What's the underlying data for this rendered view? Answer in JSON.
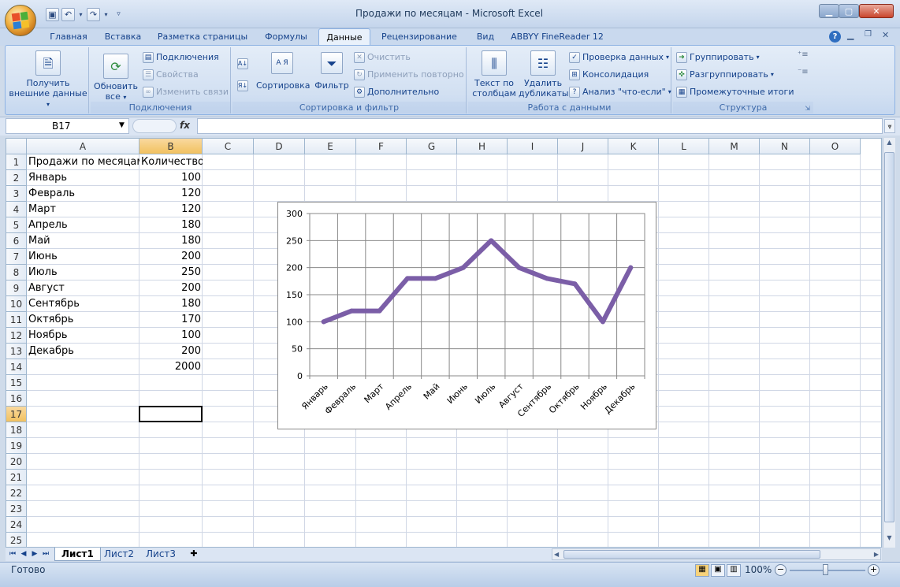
{
  "window": {
    "title": "Продажи по месяцам - Microsoft Excel",
    "controls": [
      "minimize-icon",
      "maximize-icon",
      "close-icon"
    ]
  },
  "quick_access": [
    "save-icon",
    "undo-icon",
    "redo-icon",
    "customize-icon"
  ],
  "ribbon_tabs": [
    {
      "label": "Главная"
    },
    {
      "label": "Вставка"
    },
    {
      "label": "Разметка страницы"
    },
    {
      "label": "Формулы"
    },
    {
      "label": "Данные",
      "active": true
    },
    {
      "label": "Рецензирование"
    },
    {
      "label": "Вид"
    },
    {
      "label": "ABBYY FineReader 12"
    }
  ],
  "ribbon": {
    "get_external": {
      "line1": "Получить",
      "line2": "внешние данные"
    },
    "connections": {
      "label": "Подключения",
      "refresh_line1": "Обновить",
      "refresh_line2": "все",
      "connections_btn": "Подключения",
      "properties_btn": "Свойства",
      "edit_links_btn": "Изменить связи"
    },
    "sort_filter": {
      "label": "Сортировка и фильтр",
      "sort_asc": "А Я",
      "sort_btn": "Сортировка",
      "filter_btn": "Фильтр",
      "clear_btn": "Очистить",
      "reapply_btn": "Применить повторно",
      "advanced_btn": "Дополнительно"
    },
    "data_tools": {
      "label": "Работа с данными",
      "text_to_cols_line1": "Текст по",
      "text_to_cols_line2": "столбцам",
      "remove_dup_line1": "Удалить",
      "remove_dup_line2": "дубликаты",
      "validation_btn": "Проверка данных",
      "consolidate_btn": "Консолидация",
      "whatif_btn": "Анализ \"что-если\""
    },
    "outline": {
      "label": "Структура",
      "group_btn": "Группировать",
      "ungroup_btn": "Разгруппировать",
      "subtotal_btn": "Промежуточные итоги"
    }
  },
  "formula_bar": {
    "name_box": "B17",
    "fx": "fx",
    "formula": ""
  },
  "columns": [
    "A",
    "B",
    "C",
    "D",
    "E",
    "F",
    "G",
    "H",
    "I",
    "J",
    "K",
    "L",
    "M",
    "N",
    "O"
  ],
  "rows": [
    "1",
    "2",
    "3",
    "4",
    "5",
    "6",
    "7",
    "8",
    "9",
    "10",
    "11",
    "12",
    "13",
    "14",
    "15",
    "16",
    "17",
    "18",
    "19",
    "20",
    "21",
    "22",
    "23",
    "24",
    "25"
  ],
  "selected_cell": {
    "column": "B",
    "row": "17"
  },
  "table": {
    "header_a": "Продажи по месяцам",
    "header_b": "Количество",
    "data": [
      {
        "month": "Январь",
        "qty": "100"
      },
      {
        "month": "Февраль",
        "qty": "120"
      },
      {
        "month": "Март",
        "qty": "120"
      },
      {
        "month": "Апрель",
        "qty": "180"
      },
      {
        "month": "Май",
        "qty": "180"
      },
      {
        "month": "Июнь",
        "qty": "200"
      },
      {
        "month": "Июль",
        "qty": "250"
      },
      {
        "month": "Август",
        "qty": "200"
      },
      {
        "month": "Сентябрь",
        "qty": "180"
      },
      {
        "month": "Октябрь",
        "qty": "170"
      },
      {
        "month": "Ноябрь",
        "qty": "100"
      },
      {
        "month": "Декабрь",
        "qty": "200"
      }
    ],
    "total": "2000"
  },
  "chart_data": {
    "type": "line",
    "categories": [
      "Январь",
      "Февраль",
      "Март",
      "Апрель",
      "Май",
      "Июнь",
      "Июль",
      "Август",
      "Сентябрь",
      "Октябрь",
      "Ноябрь",
      "Декабрь"
    ],
    "series": [
      {
        "values": [
          100,
          120,
          120,
          180,
          180,
          200,
          250,
          200,
          180,
          170,
          100,
          200
        ],
        "color": "#7b5ea7"
      }
    ],
    "ylim": [
      0,
      300
    ],
    "yticks": [
      "0",
      "50",
      "100",
      "150",
      "200",
      "250",
      "300"
    ],
    "grid": true,
    "legend": "none"
  },
  "sheets": [
    {
      "label": "Лист1",
      "active": true
    },
    {
      "label": "Лист2"
    },
    {
      "label": "Лист3"
    }
  ],
  "status": {
    "ready": "Готово",
    "zoom": "100%"
  }
}
